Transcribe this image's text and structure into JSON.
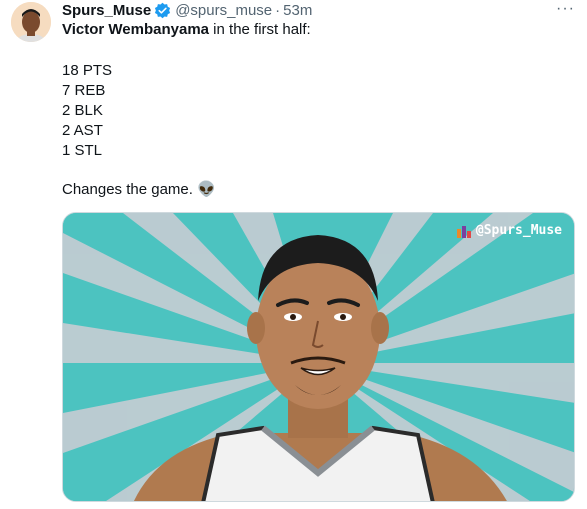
{
  "user": {
    "display_name": "Spurs_Muse",
    "handle": "@spurs_muse",
    "separator": "·",
    "time": "53m"
  },
  "tweet": {
    "player": "Victor Wembanyama",
    "intro_rest": " in the first half:",
    "stats": [
      "18 PTS",
      "7 REB",
      "2 BLK",
      "2 AST",
      "1 STL"
    ],
    "closing": "Changes the game. 👽"
  },
  "media": {
    "watermark": "@Spurs_Muse"
  },
  "icons": {
    "verified": "verified-badge-icon",
    "more": "more-horizontal-icon",
    "watermark": "bar-chart-logo-icon"
  },
  "colors": {
    "verified": "#1d9bf0",
    "text_primary": "#0f1419",
    "text_secondary": "#536471",
    "media_teal": "#4cc3c0"
  }
}
